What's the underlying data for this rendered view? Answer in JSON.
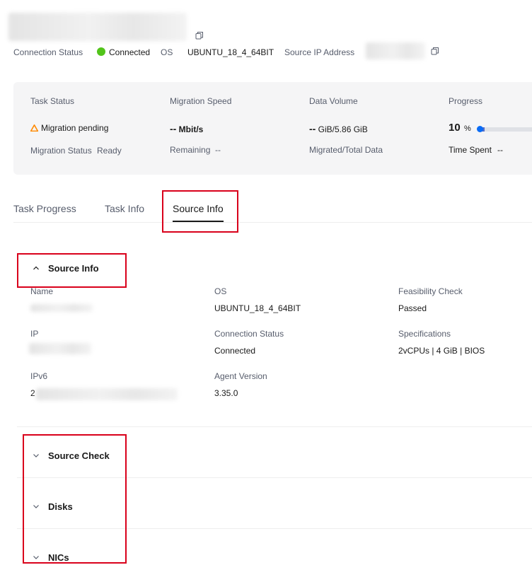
{
  "header": {
    "connection_status_label": "Connection Status",
    "connection_status_value": "Connected",
    "os_label": "OS",
    "os_value": "UBUNTU_18_4_64BIT",
    "source_ip_label": "Source IP Address"
  },
  "status_panel": {
    "task_status_label": "Task Status",
    "task_status_value": "Migration pending",
    "migration_speed_label": "Migration Speed",
    "migration_speed_dashes": "--",
    "migration_speed_unit": "Mbit/s",
    "data_volume_label": "Data Volume",
    "data_volume_dashes": "--",
    "data_volume_rest": "GiB/5.86 GiB",
    "progress_label": "Progress",
    "progress_value": "10",
    "progress_unit": "%",
    "progress_fraction": 0.1,
    "migration_status_label": "Migration Status",
    "migration_status_value": "Ready",
    "remaining_label": "Remaining",
    "remaining_value": "--",
    "migrated_total_label": "Migrated/Total Data",
    "time_spent_label": "Time Spent",
    "time_spent_value": "--"
  },
  "tabs": [
    {
      "label": "Task Progress",
      "active": false
    },
    {
      "label": "Task Info",
      "active": false
    },
    {
      "label": "Source Info",
      "active": true
    }
  ],
  "source_info": {
    "title": "Source Info",
    "name_label": "Name",
    "os_label": "OS",
    "os_value": "UBUNTU_18_4_64BIT",
    "feasibility_label": "Feasibility Check",
    "feasibility_value": "Passed",
    "ip_label": "IP",
    "connection_label": "Connection Status",
    "connection_value": "Connected",
    "specifications_label": "Specifications",
    "specifications_value": "2vCPUs | 4 GiB | BIOS",
    "ipv6_label": "IPv6",
    "ipv6_prefix": "2",
    "agent_label": "Agent Version",
    "agent_value": "3.35.0"
  },
  "sections": {
    "source_check": "Source Check",
    "disks": "Disks",
    "nics": "NICs"
  },
  "colors": {
    "connected": "#52c41a",
    "warning": "#ff8a00",
    "progress": "#0a6cf5",
    "highlight": "#d9001b"
  }
}
